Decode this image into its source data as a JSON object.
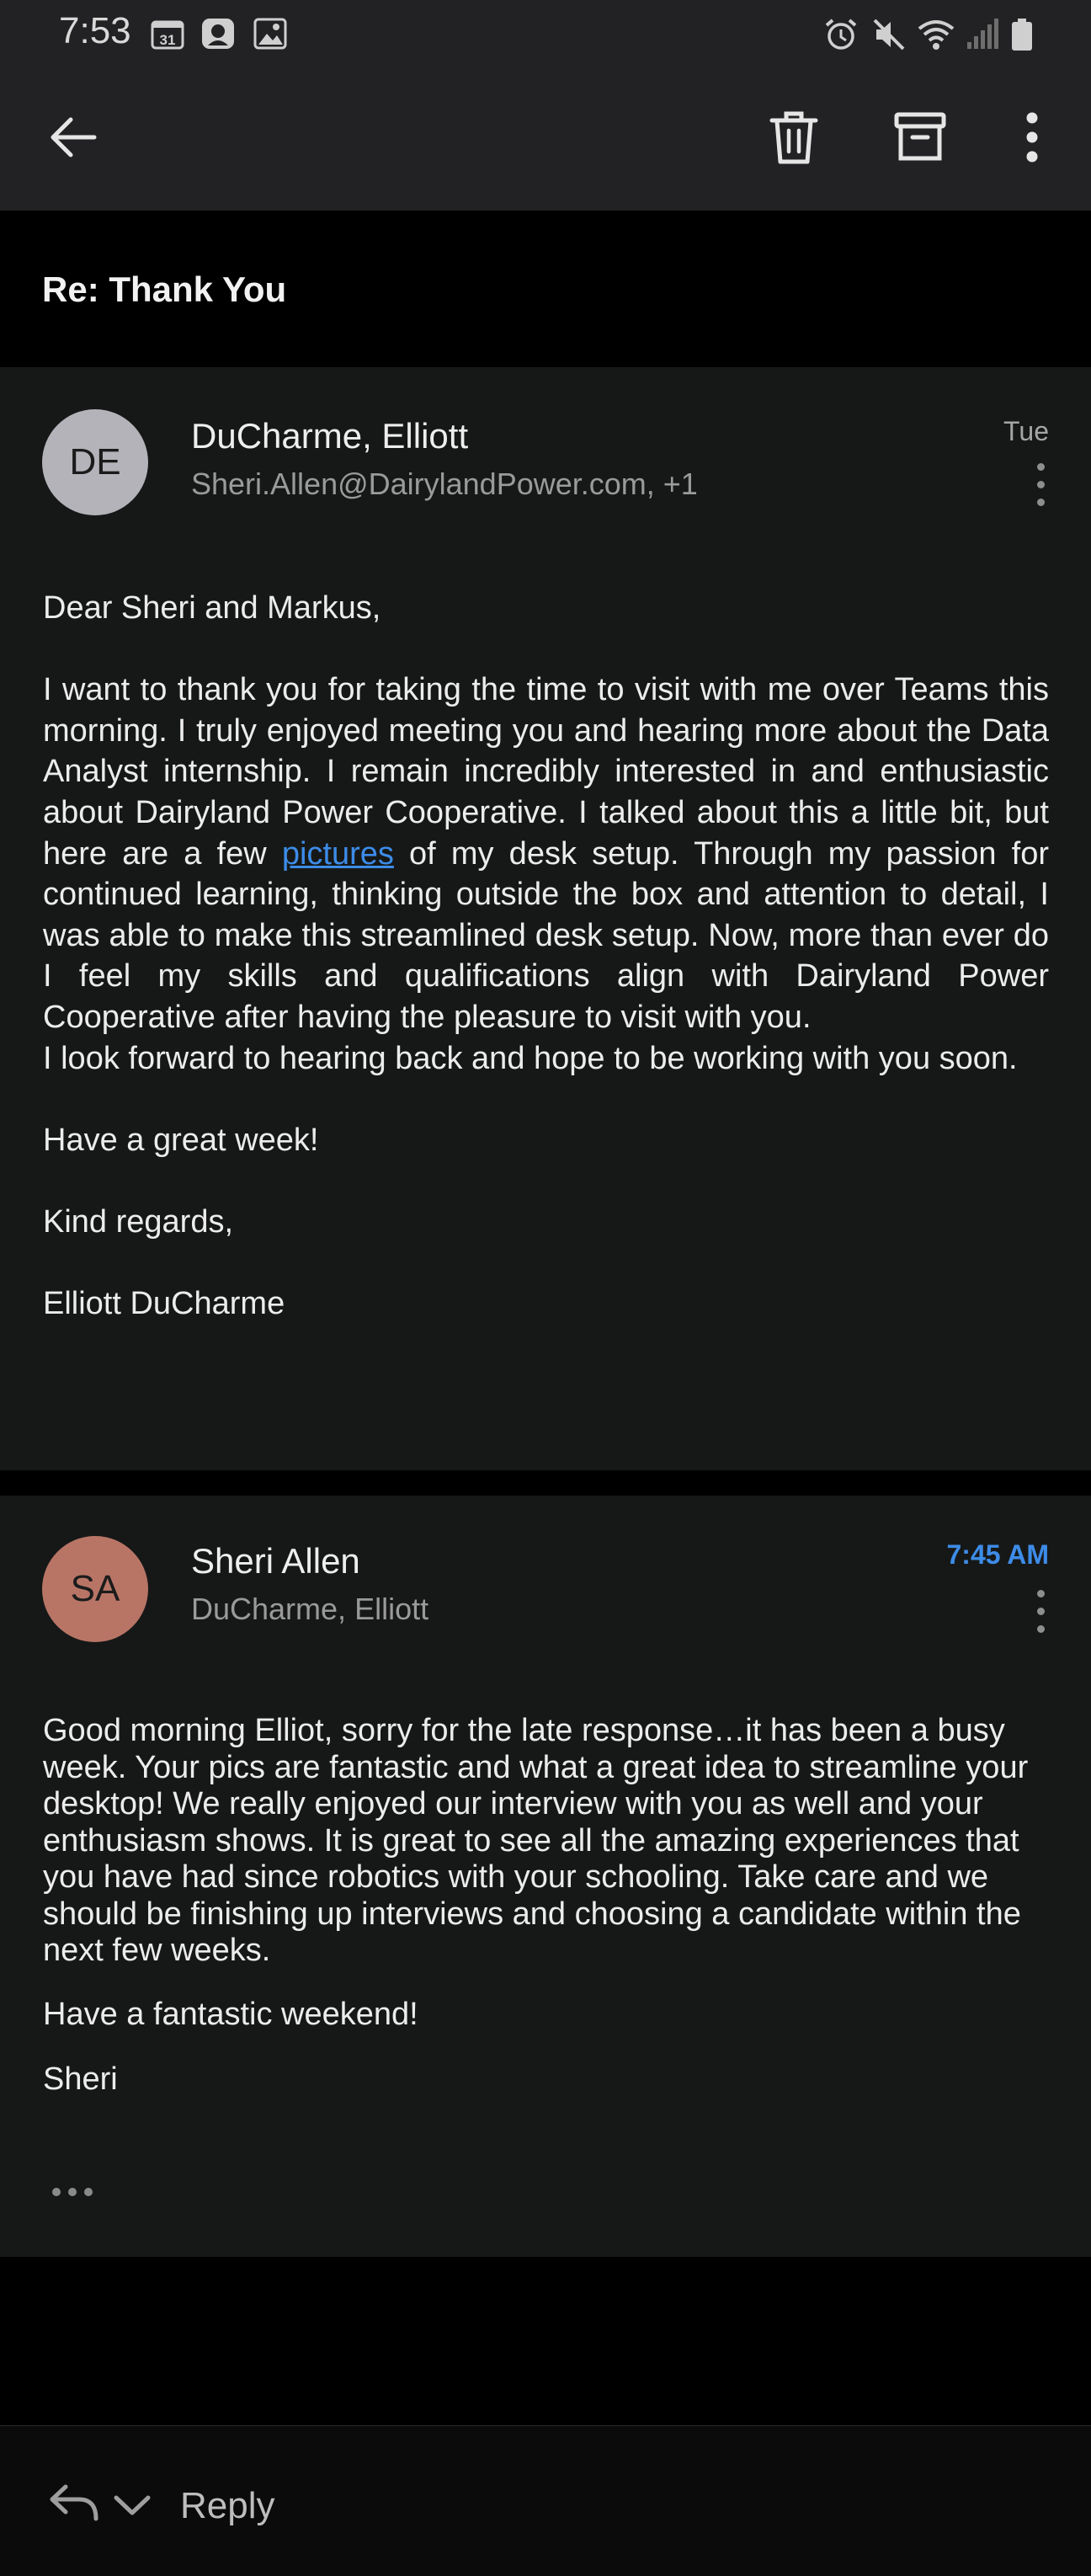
{
  "status_bar": {
    "time": "7:53",
    "calendar_badge": "31",
    "left_icons": [
      "calendar-icon",
      "messenger-icon",
      "gallery-icon"
    ],
    "right_icons": [
      "alarm-icon",
      "mute-icon",
      "wifi-icon",
      "signal-icon",
      "battery-icon"
    ]
  },
  "toolbar": {
    "back_icon": "arrow-left-icon",
    "actions": [
      "trash-icon",
      "archive-icon",
      "more-vert-icon"
    ]
  },
  "subject": "Re: Thank You",
  "message1": {
    "initials": "DE",
    "avatar_color": "#b3b3b9",
    "sender": "DuCharme, Elliott",
    "recipients": "Sheri.Allen@DairylandPower.com, +1",
    "date": "Tue",
    "greeting": "Dear Sheri and Markus,",
    "para_before_link": "I want to thank you for taking the time to visit with me over Teams this morning. I truly enjoyed meeting you and hearing more about the Data Analyst internship. I remain incredibly interested in and enthusiastic about Dairyland Power Cooperative. I talked about this a little bit, but here are a few",
    "link_text": "pictures",
    "para_after_link": " of my desk setup. Through my passion for continued learning, thinking outside the box and attention to detail, I was able to make this streamlined desk setup. Now, more than ever do I feel my skills and qualifications align with Dairyland Power Cooperative after having the pleasure to visit with you.",
    "para2": "I look forward to hearing back and hope to be working with you soon.",
    "closing1": "Have a great week!",
    "closing2": "Kind regards,",
    "signature": "Elliott DuCharme"
  },
  "message2": {
    "initials": "SA",
    "avatar_color": "#b87566",
    "sender": "Sheri Allen",
    "recipients": "DuCharme, Elliott",
    "date": "7:45 AM",
    "date_color": "#3d8ce8",
    "body": "Good morning Elliot, sorry for the late response…it has been a busy week.  Your pics are fantastic and what a great idea to streamline your desktop!  We really enjoyed our interview with you as well and your enthusiasm shows.  It is great to see all the amazing experiences that you have had since robotics with your schooling.  Take care and we should be finishing up interviews and choosing a candidate within the next few weeks.",
    "closing": "Have a fantastic weekend!",
    "signature": "Sheri",
    "show_more_icon": "ellipsis-icon"
  },
  "reply_bar": {
    "reply_icon": "reply-icon",
    "dropdown_icon": "chevron-down-icon",
    "label": "Reply"
  }
}
